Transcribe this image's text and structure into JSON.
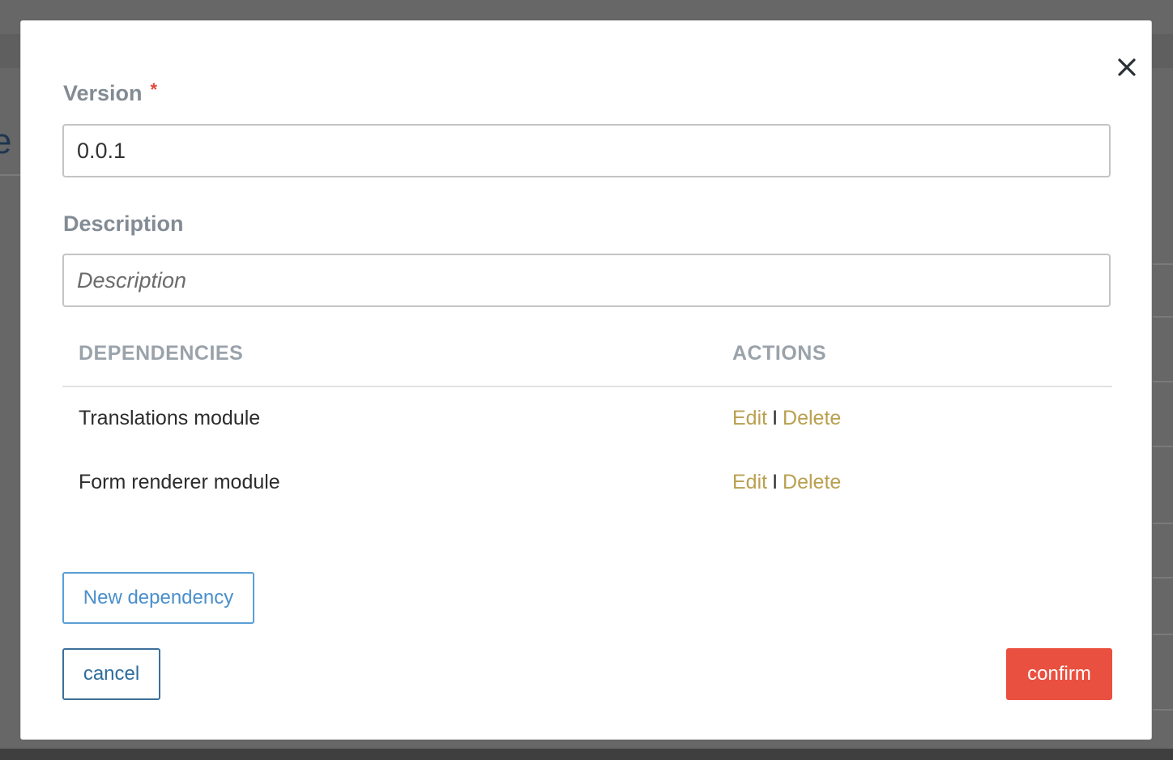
{
  "background": {
    "glyph": "e"
  },
  "form": {
    "version_label": "Version",
    "required_marker": "*",
    "version_value": "0.0.1",
    "description_label": "Description",
    "description_placeholder": "Description",
    "description_value": ""
  },
  "table": {
    "headers": {
      "dependencies": "DEPENDENCIES",
      "actions": "ACTIONS"
    },
    "rows": [
      {
        "name": "Translations module",
        "edit": "Edit",
        "separator": "I",
        "delete": "Delete"
      },
      {
        "name": "Form renderer module",
        "edit": "Edit",
        "separator": "I",
        "delete": "Delete"
      }
    ]
  },
  "buttons": {
    "new_dependency": "New dependency",
    "cancel": "cancel",
    "confirm": "confirm"
  },
  "icons": {
    "close": "close-icon"
  },
  "colors": {
    "accent_link": "#b9a04f",
    "confirm": "#ea5040",
    "primary_outline": "#5a9fd6",
    "required": "#e04a3b"
  }
}
